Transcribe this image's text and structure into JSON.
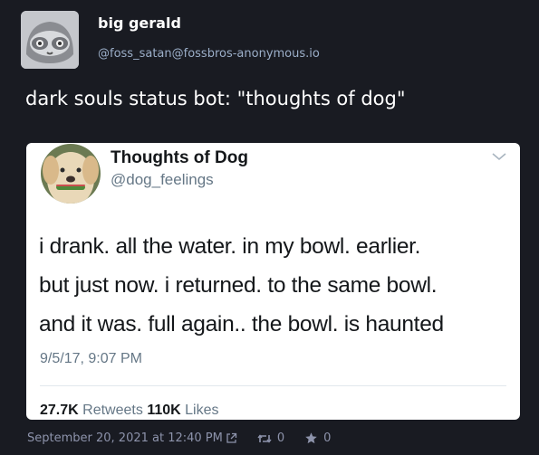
{
  "status": {
    "author": {
      "display_name": "big gerald",
      "handle": "@foss_satan@fossbros-anonymous.io",
      "avatar_icon": "sloth-avatar-icon"
    },
    "content": "dark souls status bot: \"thoughts of dog\"",
    "timestamp": "September 20, 2021 at 12:40 PM",
    "boosts": "0",
    "favourites": "0"
  },
  "tweet": {
    "name": "Thoughts of Dog",
    "handle": "@dog_feelings",
    "lines": [
      "i drank. all the water. in my bowl. earlier.",
      "but just now. i returned. to the same bowl.",
      "and it was. full again.. the bowl. is haunted"
    ],
    "date": "9/5/17, 9:07 PM",
    "retweets_count": "27.7K",
    "retweets_label": "Retweets",
    "likes_count": "110K",
    "likes_label": "Likes"
  },
  "colors": {
    "background": "#191b22",
    "secondary_text": "#9baec8",
    "tweet_text": "#14171a",
    "tweet_muted": "#657786"
  }
}
